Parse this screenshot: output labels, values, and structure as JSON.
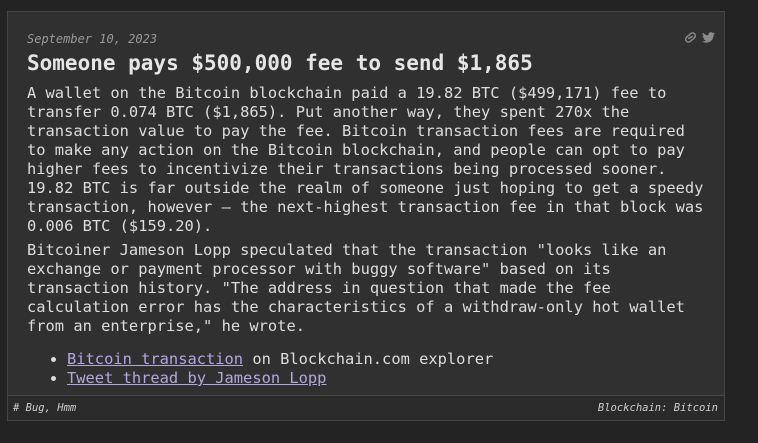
{
  "post": {
    "date": "September 10, 2023",
    "title": "Someone pays $500,000 fee to send $1,865",
    "paragraphs": [
      "A wallet on the Bitcoin blockchain paid a 19.82 BTC ($499,171) fee to transfer 0.074 BTC ($1,865). Put another way, they spent 270x the transaction value to pay the fee. Bitcoin transaction fees are required to make any action on the Bitcoin blockchain, and people can opt to pay higher fees to incentivize their transactions being processed sooner. 19.82 BTC is far outside the realm of someone just hoping to get a speedy transaction, however — the next-highest transaction fee in that block was 0.006 BTC ($159.20).",
      "Bitcoiner Jameson Lopp speculated that the transaction \"looks like an exchange or payment processor with buggy software\" based on its transaction history. \"The address in question that made the fee calculation error has the characteristics of a withdraw-only hot wallet from an enterprise,\" he wrote."
    ],
    "links": [
      {
        "text": "Bitcoin transaction",
        "suffix": " on Blockchain.com explorer"
      },
      {
        "text": "Tweet thread by Jameson Lopp",
        "suffix": ""
      }
    ],
    "icons": [
      "link-icon",
      "twitter-icon"
    ]
  },
  "footer": {
    "tags": "# Bug, Hmm",
    "category": "Blockchain: Bitcoin"
  },
  "colors": {
    "background": "#232323",
    "card": "#303030",
    "link": "#b4a7e0"
  }
}
